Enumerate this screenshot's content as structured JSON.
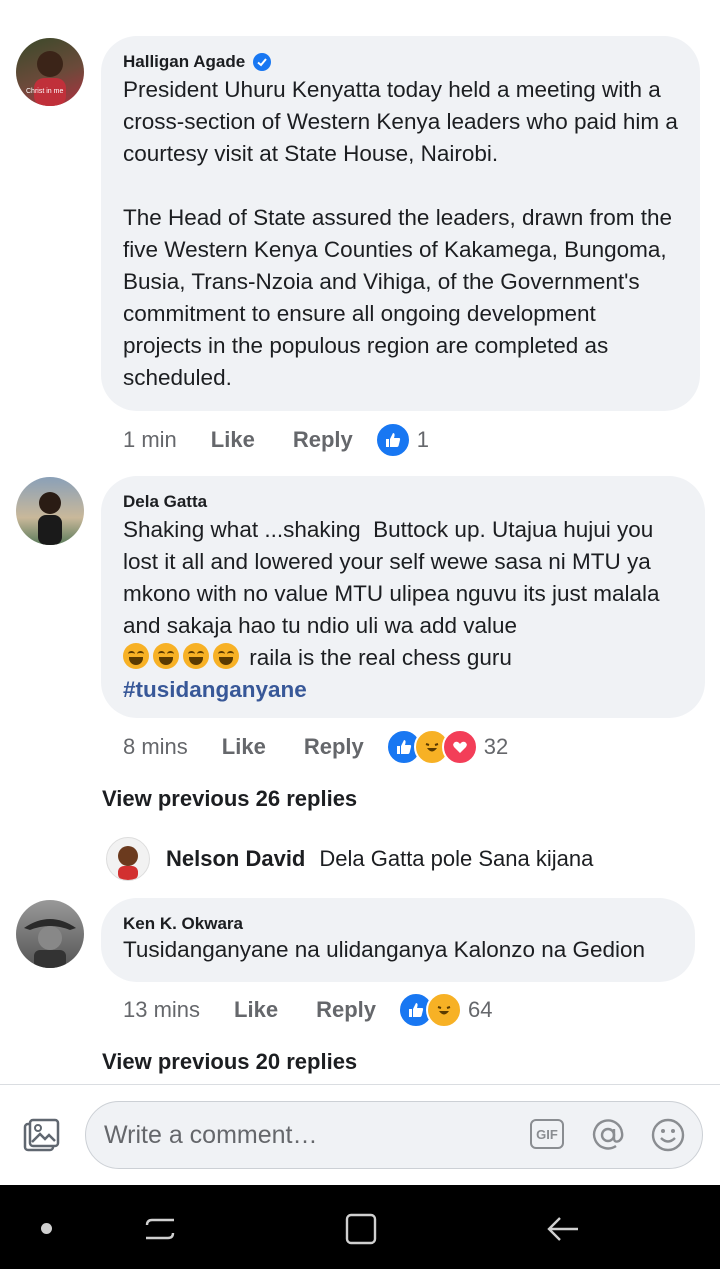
{
  "comments": [
    {
      "author": "Halligan Agade",
      "verified": true,
      "text": "President Uhuru Kenyatta today held a meeting with a cross-section of Western Kenya leaders who paid him a courtesy visit at State House, Nairobi.\n\nThe Head of State assured the leaders, drawn from the five Western Kenya Counties of Kakamega, Bungoma, Busia, Trans-Nzoia and Vihiga, of the Government's commitment to ensure all ongoing development projects in the populous region are completed as scheduled.",
      "time": "1 min",
      "like_label": "Like",
      "reply_label": "Reply",
      "reaction_count": "1",
      "avatar_caption": "Christ in me"
    },
    {
      "author": "Dela Gatta",
      "text": "Shaking what ...shaking  Buttock up. Utajua hujui you lost it all and lowered your self wewe sasa ni MTU ya mkono with no value MTU ulipea nguvu its just malala and sakaja hao tu ndio uli wa add value",
      "emoji_text": "raila is the real chess guru",
      "hashtag": "#tusidanganyane",
      "time": "8 mins",
      "like_label": "Like",
      "reply_label": "Reply",
      "reaction_count": "32"
    },
    {
      "author": "Ken K. Okwara",
      "text": "Tusidanganyane na ulidanganya Kalonzo na Gedion",
      "time": "13 mins",
      "like_label": "Like",
      "reply_label": "Reply",
      "reaction_count": "64"
    }
  ],
  "view_previous_1": "View previous 26 replies",
  "reply_preview": {
    "author": "Nelson David",
    "text": "Dela Gatta pole Sana kijana"
  },
  "view_previous_2": "View previous 20 replies",
  "composer": {
    "placeholder": "Write a comment…",
    "gif_label": "GIF"
  },
  "colors": {
    "like_blue": "#1877f2",
    "bubble": "#f0f2f5",
    "hashtag": "#385898"
  }
}
